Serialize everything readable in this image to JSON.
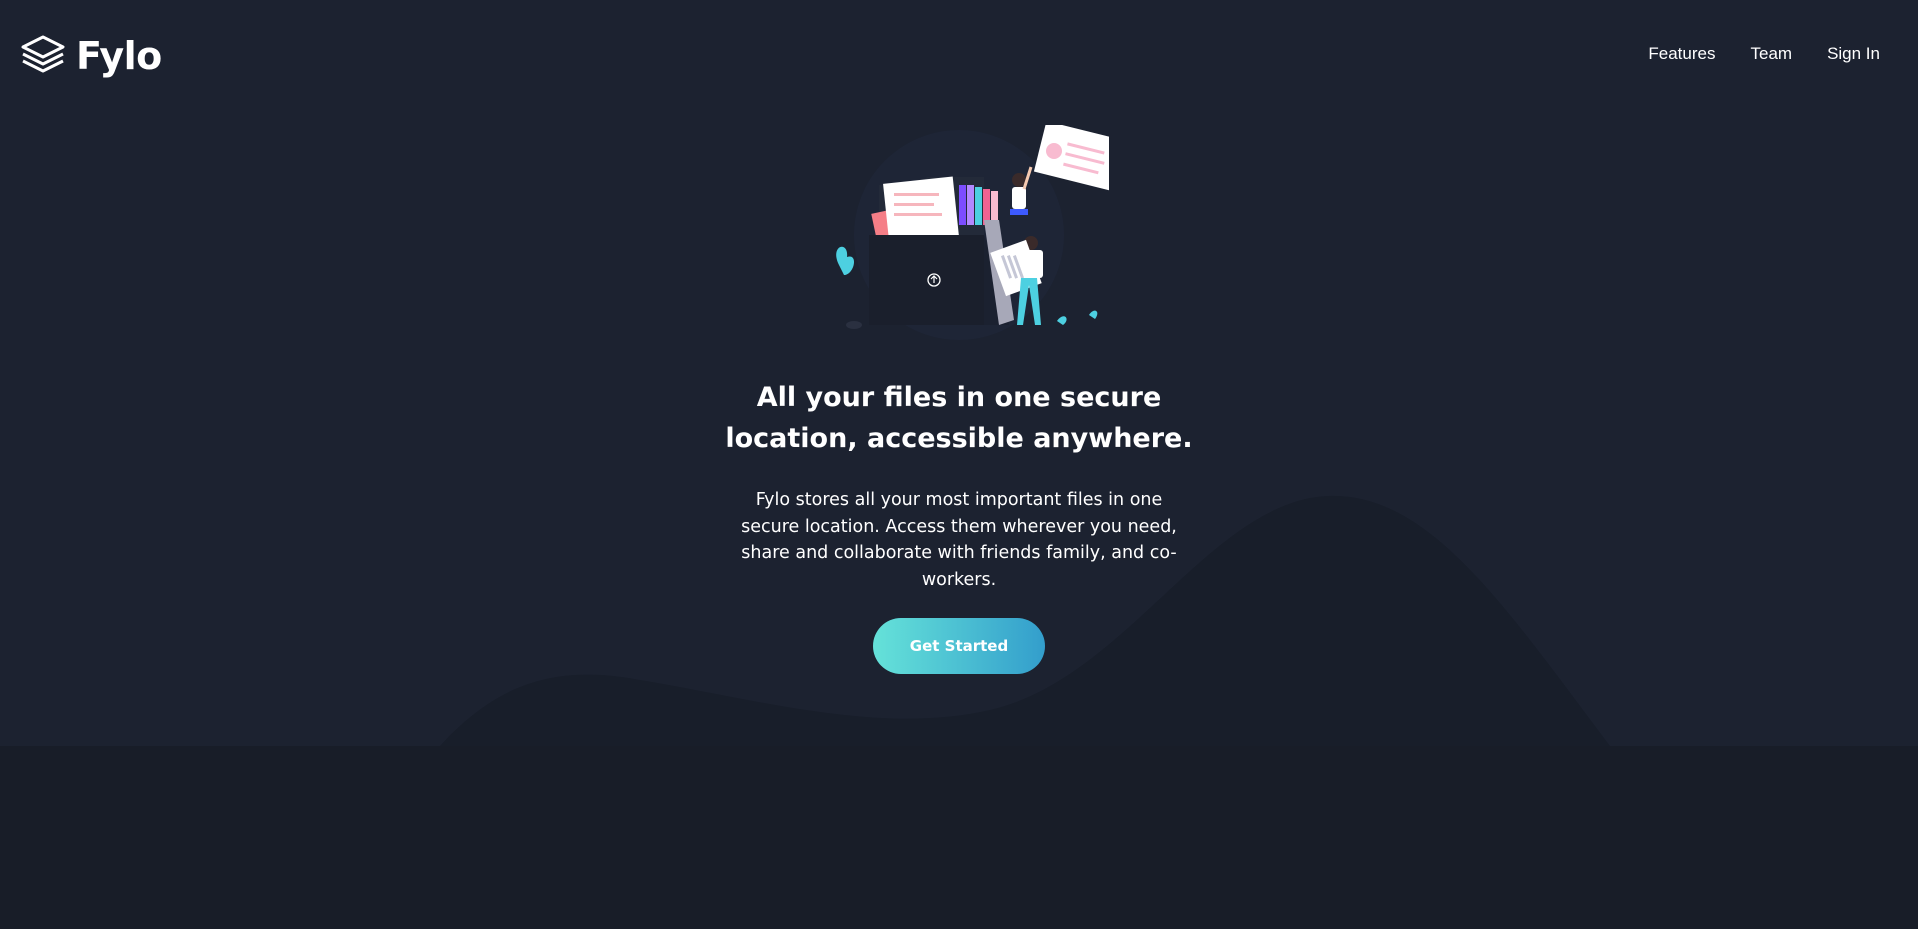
{
  "brand": {
    "name": "Fylo",
    "logo_icon": "layers-icon"
  },
  "nav": {
    "items": [
      {
        "label": "Features"
      },
      {
        "label": "Team"
      },
      {
        "label": "Sign In"
      }
    ]
  },
  "hero": {
    "illustration": "illustration-intro",
    "title": "All your files in one secure location, accessible anywhere.",
    "subtitle": "Fylo stores all your most important files in one secure location. Access them wherever you need, share and collaborate with friends family, and co-workers.",
    "cta_label": "Get Started"
  },
  "colors": {
    "background": "#1c2230",
    "background_dark": "#181d28",
    "cta_gradient_start": "#65e2d9",
    "cta_gradient_end": "#339ecc",
    "text": "#ffffff"
  }
}
